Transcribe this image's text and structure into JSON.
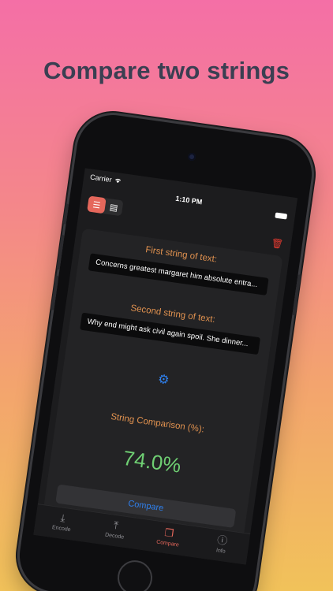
{
  "headline": "Compare two strings",
  "status": {
    "carrier": "Carrier",
    "time": "1:10 PM"
  },
  "toolbar": {
    "mode_text_icon": "text-lines-icon",
    "mode_file_icon": "document-icon",
    "trash_icon": "trash-icon"
  },
  "first": {
    "label": "First string of text:",
    "value": "Concerns greatest margaret him absolute entra..."
  },
  "second": {
    "label": "Second string of text:",
    "value": "Why end might ask civil again spoil. She dinner..."
  },
  "result": {
    "label": "String Comparison (%):",
    "value": "74.0%"
  },
  "compare_button": "Compare",
  "tabs": [
    {
      "label": "Encode",
      "icon": "tray-download-icon"
    },
    {
      "label": "Decode",
      "icon": "tray-upload-icon"
    },
    {
      "label": "Compare",
      "icon": "documents-icon"
    },
    {
      "label": "Info",
      "icon": "info-icon"
    }
  ],
  "colors": {
    "accent": "#e5675b",
    "label": "#e0914f",
    "result": "#6fcf73",
    "link": "#2f80ee"
  }
}
